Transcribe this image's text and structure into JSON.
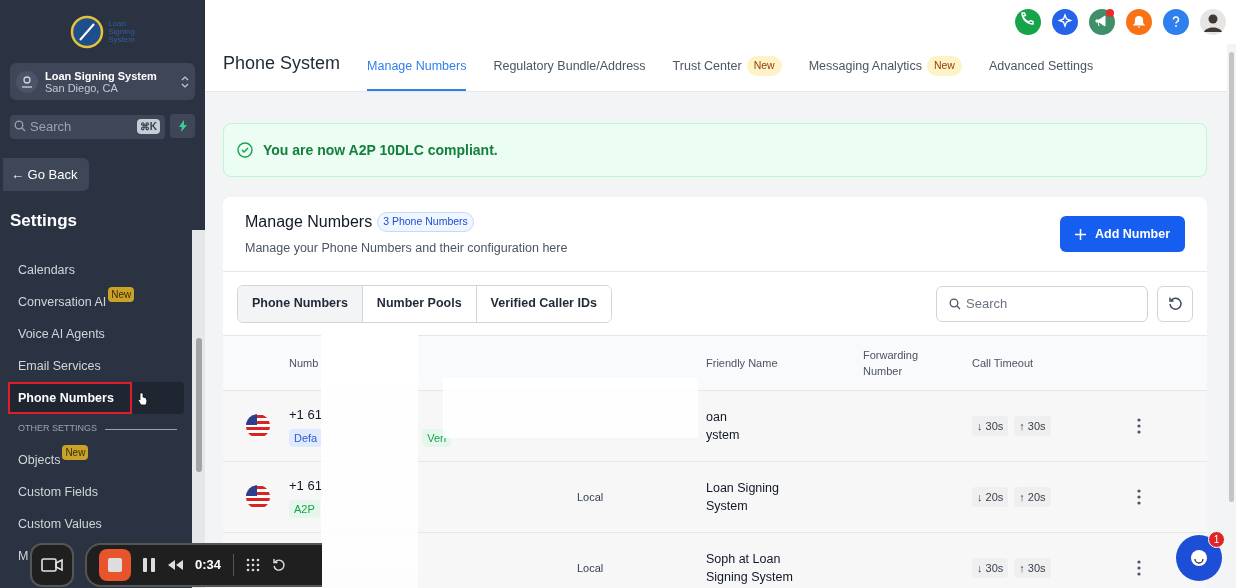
{
  "sidebar": {
    "logo_text": [
      "Loan",
      "Signing",
      "System"
    ],
    "account": {
      "name": "Loan Signing System",
      "location": "San Diego, CA"
    },
    "search": {
      "placeholder": "Search",
      "shortcut": "⌘K"
    },
    "go_back": "← Go Back",
    "title": "Settings",
    "items": [
      {
        "kind": "item",
        "label": "Calendars",
        "selected": false
      },
      {
        "kind": "item",
        "label": "Conversation AI",
        "badge": "New",
        "selected": false
      },
      {
        "kind": "item",
        "label": "Voice AI Agents",
        "selected": false
      },
      {
        "kind": "item",
        "label": "Email Services",
        "selected": false
      },
      {
        "kind": "item",
        "label": "Phone Numbers",
        "selected": true
      },
      {
        "kind": "section",
        "label": "OTHER SETTINGS"
      },
      {
        "kind": "item",
        "label": "Objects",
        "badge": "New",
        "selected": false
      },
      {
        "kind": "item",
        "label": "Custom Fields",
        "selected": false
      },
      {
        "kind": "item",
        "label": "Custom Values",
        "selected": false
      },
      {
        "kind": "item",
        "label": "M",
        "selected": false
      }
    ]
  },
  "header": {
    "title": "Phone System",
    "tabs": [
      {
        "label": "Manage Numbers",
        "selected": true
      },
      {
        "label": "Regulatory Bundle/Address",
        "selected": false
      },
      {
        "label": "Trust Center",
        "badge": "New",
        "selected": false
      },
      {
        "label": "Messaging Analytics",
        "badge": "New",
        "selected": false
      },
      {
        "label": "Advanced Settings",
        "selected": false
      }
    ]
  },
  "alert": "You are now A2P 10DLC compliant.",
  "card": {
    "title": "Manage Numbers",
    "count_badge": "3 Phone Numbers",
    "subtitle": "Manage your Phone Numbers and their configuration here",
    "add_button": "Add Number",
    "segments": [
      {
        "label": "Phone Numbers",
        "selected": true
      },
      {
        "label": "Number Pools",
        "selected": false
      },
      {
        "label": "Verified Caller IDs",
        "selected": false
      }
    ],
    "search": {
      "placeholder": "Search"
    }
  },
  "table": {
    "columns": {
      "number": "Numb",
      "friendly_name": "Friendly Name",
      "forwarding": "Forwarding Number",
      "timeout": "Call Timeout"
    },
    "rows": [
      {
        "number": "+1 61",
        "badges": [
          {
            "label": "Defa",
            "kind": "default"
          },
          {
            "label": "Veri",
            "kind": "verified"
          }
        ],
        "friendly_name": [
          "oan",
          "ystem"
        ],
        "inbound": "↓ 30s",
        "outbound": "↑ 30s"
      },
      {
        "number": "+1 61",
        "badges": [
          {
            "label": "A2P",
            "kind": "verified"
          }
        ],
        "type": "Local",
        "friendly_name": [
          "Loan Signing",
          "System"
        ],
        "inbound": "↓ 20s",
        "outbound": "↑ 20s"
      },
      {
        "type": "Local",
        "friendly_name": [
          "Soph at Loan",
          "Signing System"
        ],
        "inbound": "↓ 30s",
        "outbound": "↑ 30s"
      }
    ]
  },
  "recorder": {
    "time": "0:34"
  },
  "chat": {
    "badge": "1"
  }
}
